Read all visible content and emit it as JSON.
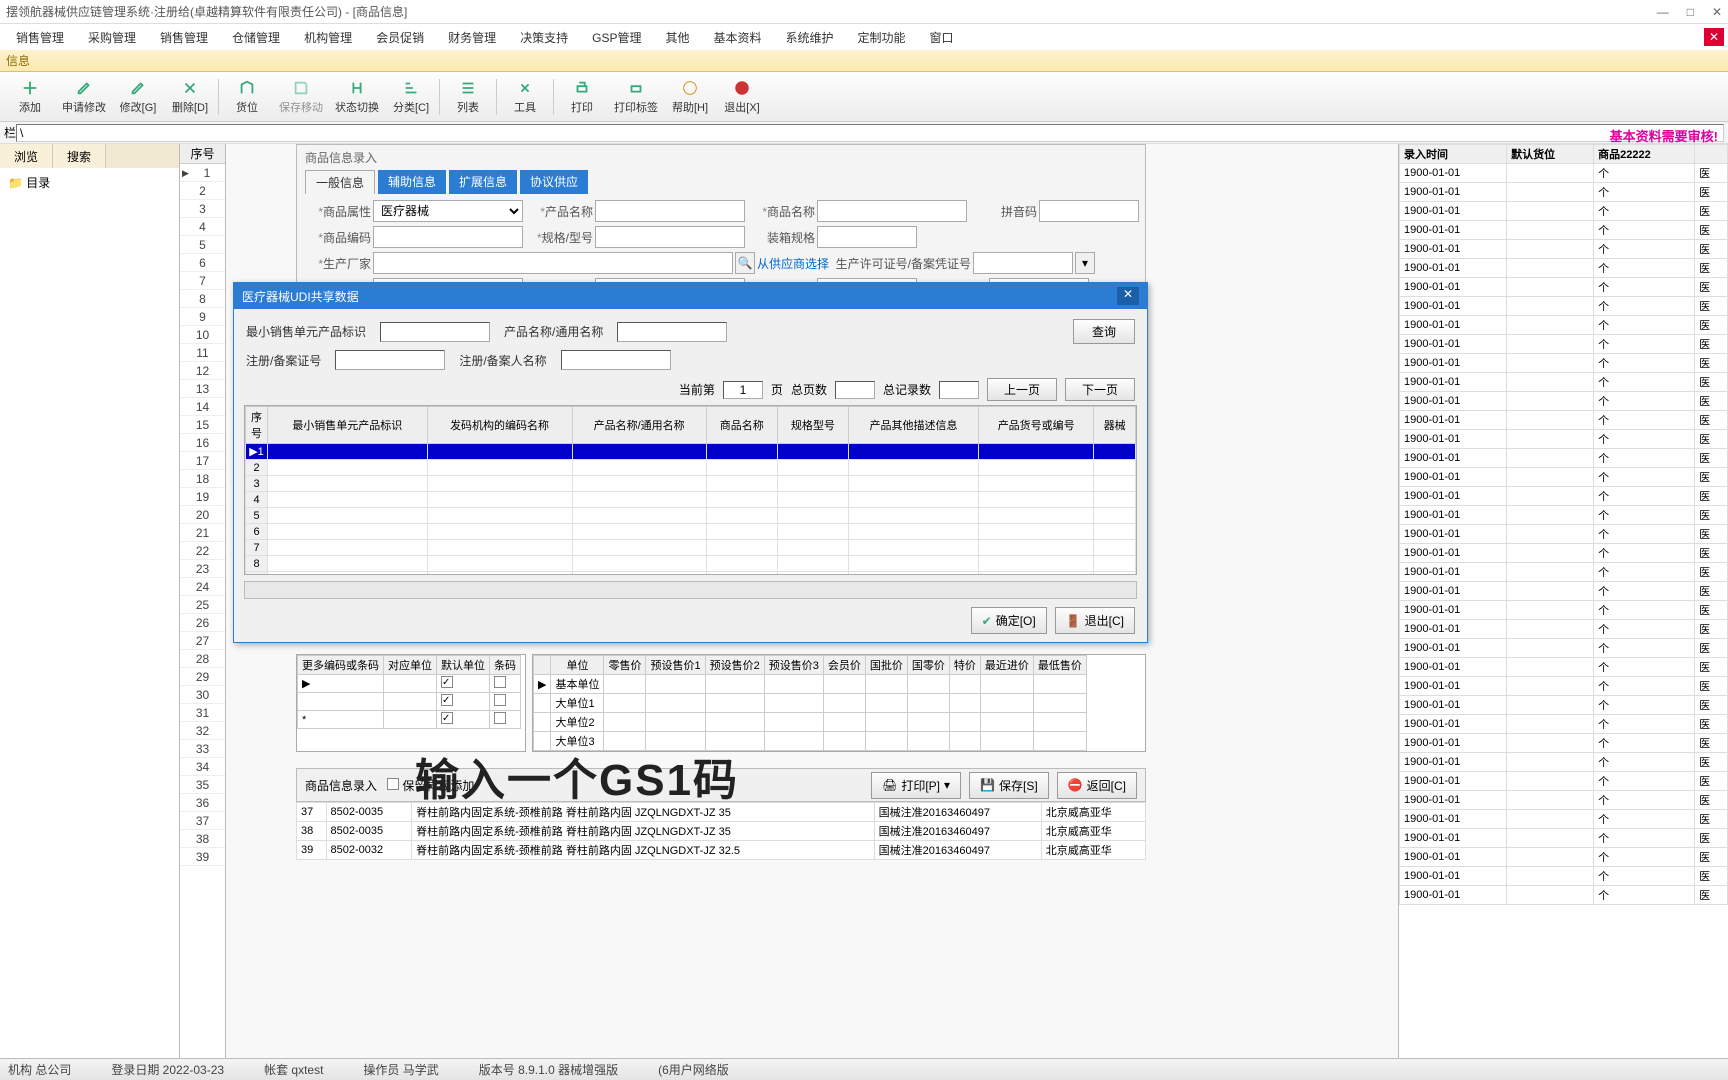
{
  "window": {
    "title": "摆领航器械供应链管理系统·注册给(卓越精算软件有限责任公司) - [商品信息]"
  },
  "menubar": [
    "销售管理",
    "采购管理",
    "销售管理",
    "仓储管理",
    "机构管理",
    "会员促销",
    "财务管理",
    "决策支持",
    "GSP管理",
    "其他",
    "基本资料",
    "系统维护",
    "定制功能",
    "窗口"
  ],
  "infobar": "信息",
  "toolbar": [
    {
      "label": "添加"
    },
    {
      "label": "申请修改"
    },
    {
      "label": "修改[G]"
    },
    {
      "label": "删除[D]"
    },
    {
      "label": "货位"
    },
    {
      "label": "保存移动"
    },
    {
      "label": "状态切换"
    },
    {
      "label": "分类[C]"
    },
    {
      "label": "列表"
    },
    {
      "label": "工具"
    },
    {
      "label": "打印"
    },
    {
      "label": "打印标签"
    },
    {
      "label": "帮助[H]"
    },
    {
      "label": "退出[X]"
    }
  ],
  "addrbar": {
    "label": "栏",
    "value": "\\"
  },
  "left": {
    "tabs": [
      "浏览",
      "搜索"
    ],
    "tree_root": "目录"
  },
  "rownum_header": "序号",
  "form": {
    "title": "商品信息录入",
    "tabs": [
      "一般信息",
      "辅助信息",
      "扩展信息",
      "协议供应"
    ],
    "fields": {
      "商品属性": "医疗器械",
      "产品名称": "",
      "商品名称": "",
      "拼音码": "",
      "商品编码": "",
      "规格/型号": "",
      "装箱规格": "",
      "生产厂家": "",
      "从供应商选择": "从供应商选择",
      "生产许可证号/备案凭证号": "",
      "产地": "",
      "检查": "",
      "检查天数": "",
      "有效期(月)": "",
      "GSP属性": "",
      "贮藏": "",
      "温度条件": ""
    }
  },
  "notice": "基本资料需要审核!",
  "dialog": {
    "title": "医疗器械UDI共享数据",
    "search": {
      "最小销售单元产品标识": "",
      "产品名称/通用名称": "",
      "注册/备案证号": "",
      "注册/备案人名称": "",
      "query_btn": "查询"
    },
    "pager": {
      "当前第": "1",
      "页": "页",
      "总页数": "总页数",
      "总记录数": "总记录数",
      "prev": "上一页",
      "next": "下一页"
    },
    "grid_headers": [
      "序号",
      "最小销售单元产品标识",
      "发码机构的编码名称",
      "产品名称/通用名称",
      "商品名称",
      "规格型号",
      "产品其他描述信息",
      "产品货号或编号",
      "器械"
    ],
    "footer": {
      "ok": "确定[O]",
      "exit": "退出[C]"
    }
  },
  "sub1": {
    "headers": [
      "更多编码或条码",
      "对应单位",
      "默认单位",
      "条码"
    ]
  },
  "sub2": {
    "headers": [
      "单位",
      "零售价",
      "预设售价1",
      "预设售价2",
      "预设售价3",
      "会员价",
      "国批价",
      "国零价",
      "特价",
      "最近进价",
      "最低售价"
    ],
    "rows": [
      "基本单位",
      "大单位1",
      "大单位2",
      "大单位3"
    ]
  },
  "bottom": {
    "title": "商品信息录入",
    "checkbox": "保留样板添加",
    "print": "打印[P]",
    "save": "保存[S]",
    "back": "返回[C]"
  },
  "bottom_rows": [
    {
      "c1": "8502-0035",
      "c2": "脊柱前路内固定系统-颈椎前路 脊柱前路内固 JZQLNGDXT-JZ 35",
      "c3": "国械注准20163460497",
      "c4": "北京威高亚华"
    },
    {
      "c1": "8502-0032",
      "c2": "脊柱前路内固定系统-颈椎前路 脊柱前路内固 JZQLNGDXT-JZ 32.5",
      "c3": "国械注准20163460497",
      "c4": "北京威高亚华"
    }
  ],
  "right_grid": {
    "headers": [
      "录入时间",
      "默认货位",
      "商品22222"
    ],
    "date": "1900-01-01",
    "unit": "个",
    "cat": "医"
  },
  "statusbar": {
    "org": "机构 总公司",
    "login": "登录日期 2022-03-23",
    "acct": "帐套 qxtest",
    "oper": "操作员 马学武",
    "ver": "版本号 8.9.1.0 器械增强版",
    "net": "(6用户网络版"
  },
  "overlay": "输入一个GS1码"
}
